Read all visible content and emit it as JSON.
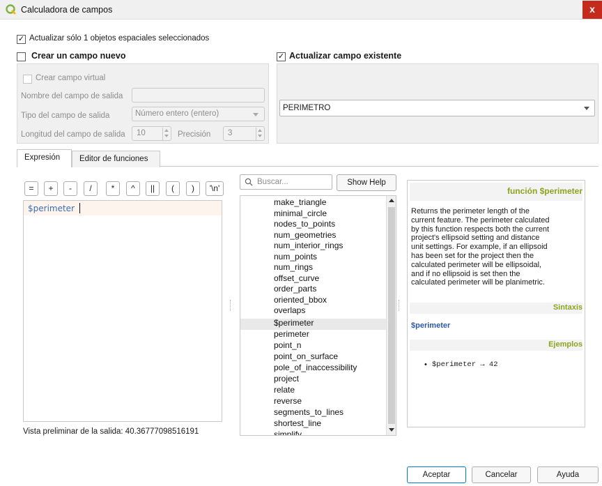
{
  "window": {
    "title": "Calculadora de campos",
    "close_label": "x"
  },
  "top_checkbox": {
    "label": "Actualizar sólo 1 objetos espaciales seleccionados",
    "checked": true
  },
  "new_field": {
    "label": "Crear un campo nuevo",
    "virtual_label": "Crear campo virtual",
    "name_label": "Nombre del campo de salida",
    "type_label": "Tipo del campo de salida",
    "type_value": "Número entero (entero)",
    "length_label": "Longitud del campo de salida",
    "length_value": "10",
    "precision_label": "Precisión",
    "precision_value": "3"
  },
  "update_field": {
    "label": "Actualizar campo existente",
    "checked": true,
    "value": "PERIMETRO"
  },
  "tabs": [
    "Expresión",
    "Editor de funciones"
  ],
  "operators": [
    "=",
    "+",
    "-",
    "/",
    "*",
    "^",
    "||",
    "(",
    ")",
    "'\\n'"
  ],
  "expression": "$perimeter",
  "preview": "Vista preliminar de la salida: 40.36777098516191",
  "search": {
    "placeholder": "Buscar...",
    "show_help": "Show Help"
  },
  "functions": [
    "make_triangle",
    "minimal_circle",
    "nodes_to_points",
    "num_geometries",
    "num_interior_rings",
    "num_points",
    "num_rings",
    "offset_curve",
    "order_parts",
    "oriented_bbox",
    "overlaps",
    "$perimeter",
    "perimeter",
    "point_n",
    "point_on_surface",
    "pole_of_inaccessibility",
    "project",
    "relate",
    "reverse",
    "segments_to_lines",
    "shortest_line",
    "simplify"
  ],
  "selected_function": "$perimeter",
  "help": {
    "title": "función $perimeter",
    "description": [
      "Returns the perimeter length of the",
      "current feature. The perimeter calculated",
      "by this function respects both the current",
      "project's ellipsoid setting and distance",
      "unit settings. For example, if an ellipsoid",
      "has been set for the project then the",
      "calculated perimeter will be ellipsoidal,",
      "and if no ellipsoid is set then the",
      "calculated perimeter will be planimetric."
    ],
    "syntax_header": "Sintaxis",
    "syntax": "$perimeter",
    "examples_header": "Ejemplos",
    "example": "$perimeter → 42"
  },
  "buttons": {
    "ok": "Aceptar",
    "cancel": "Cancelar",
    "help": "Ayuda"
  },
  "colors": {
    "accent_green": "#8aa51e",
    "syntax_blue": "#2c5aa0",
    "expr_blue": "#3a6fb0"
  }
}
